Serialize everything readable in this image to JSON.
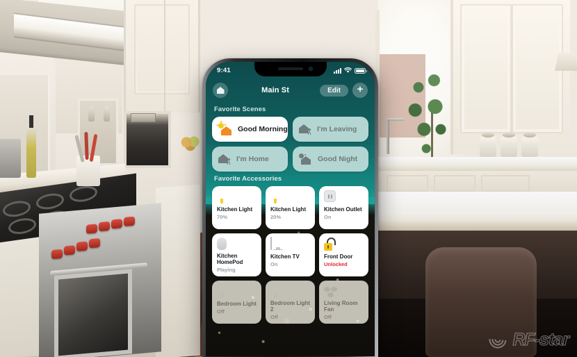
{
  "watermark": {
    "text": "RF-star",
    "logo_icon": "signal-wave-icon"
  },
  "phone": {
    "status_bar": {
      "time": "9:41",
      "cellular_icon": "signal-bars-icon",
      "wifi_icon": "wifi-icon",
      "battery_icon": "battery-full-icon"
    },
    "nav": {
      "home_icon": "home-icon",
      "title": "Main St",
      "edit_label": "Edit",
      "add_icon": "plus-icon"
    },
    "sections": {
      "scenes_title": "Favorite Scenes",
      "accessories_title": "Favorite Accessories"
    },
    "scenes": [
      {
        "label": "Good Morning",
        "icon": "sunrise-house-icon",
        "active": true
      },
      {
        "label": "I'm Leaving",
        "icon": "house-person-icon",
        "active": false
      },
      {
        "label": "I'm Home",
        "icon": "house-person-icon",
        "active": false
      },
      {
        "label": "Good Night",
        "icon": "moon-house-icon",
        "active": false
      }
    ],
    "accessories": [
      {
        "name": "Kitchen Light",
        "status": "70%",
        "icon": "lightbulb-on-icon",
        "state": "on"
      },
      {
        "name": "Kitchen Light",
        "status": "20%",
        "icon": "lightbulb-on-icon",
        "state": "on"
      },
      {
        "name": "Kitchen Outlet",
        "status": "On",
        "icon": "power-outlet-icon",
        "state": "on"
      },
      {
        "name": "Kitchen HomePod",
        "status": "Playing",
        "icon": "homepod-icon",
        "state": "on"
      },
      {
        "name": "Kitchen TV",
        "status": "On",
        "icon": "television-icon",
        "state": "on"
      },
      {
        "name": "Front Door",
        "status": "Unlocked",
        "icon": "unlocked-padlock-icon",
        "state": "alert"
      },
      {
        "name": "Bedroom Light",
        "status": "Off",
        "icon": "lightbulb-off-icon",
        "state": "off"
      },
      {
        "name": "Bedroom Light 2",
        "status": "Off",
        "icon": "lightbulb-off-icon",
        "state": "off"
      },
      {
        "name": "Living Room Fan",
        "status": "Off",
        "icon": "ceiling-fan-icon",
        "state": "off"
      }
    ]
  },
  "colors": {
    "teal_header": "#12615f",
    "teal_accent": "#1aa39a",
    "scene_tile": "#b4d6d2",
    "bulb_yellow": "#f7cf27",
    "alert_red": "#e0283c"
  }
}
